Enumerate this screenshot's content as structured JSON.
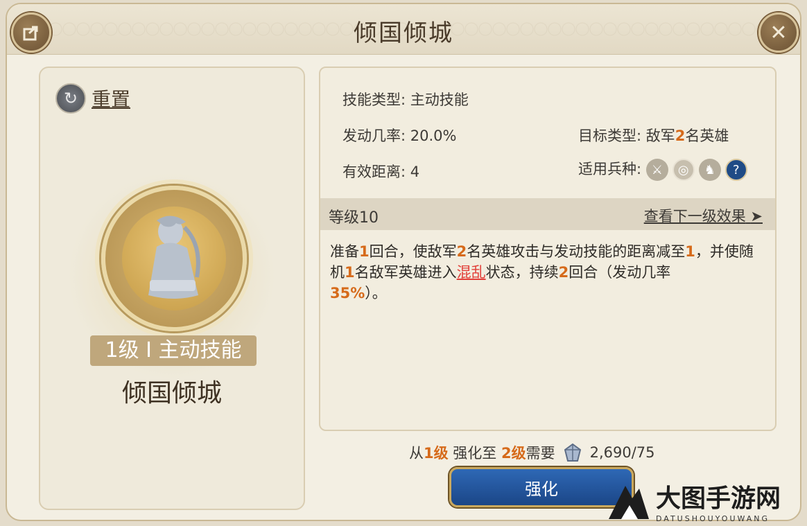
{
  "header": {
    "title": "倾国倾城"
  },
  "left": {
    "reset_label": "重置",
    "level_badge": "1级 I 主动技能",
    "skill_name": "倾国倾城"
  },
  "info": {
    "skill_type": "技能类型: 主动技能",
    "trigger_rate": "发动几率: 20.0%",
    "target_type_prefix": "目标类型: 敌军",
    "target_count": "2",
    "target_type_suffix": "名英雄",
    "range": "有效距离: 4",
    "troop_label": "适用兵种:",
    "troops": [
      "sword-icon",
      "target-icon",
      "horse-icon",
      "question-icon"
    ]
  },
  "level": {
    "current": "等级10",
    "next_link": "查看下一级效果",
    "arrow": "➤"
  },
  "description": {
    "p1": "准备",
    "n1": "1",
    "p2": "回合，使敌军",
    "n2": "2",
    "p3": "名英雄攻击与发动技能的距离减至",
    "n3": "1",
    "p4": "，并使随机",
    "n4": "1",
    "p5": "名敌军英雄进入",
    "status": "混乱",
    "p6": "状态，持续",
    "n5": "2",
    "p7": "回合（发动几率",
    "n6": "35%",
    "p8": "）。"
  },
  "cost": {
    "from": "从",
    "from_level": "1级",
    "mid": " 强化至 ",
    "to_level": "2级",
    "need": "需要",
    "amount": "2,690/75"
  },
  "upgrade_button": "强化",
  "watermark": {
    "text": "大图手游网",
    "sub": "DATUSHOUYOUWANG"
  },
  "colors": {
    "highlight": "#d66a1a",
    "status": "#e2403a",
    "button": "#2e68b5"
  }
}
